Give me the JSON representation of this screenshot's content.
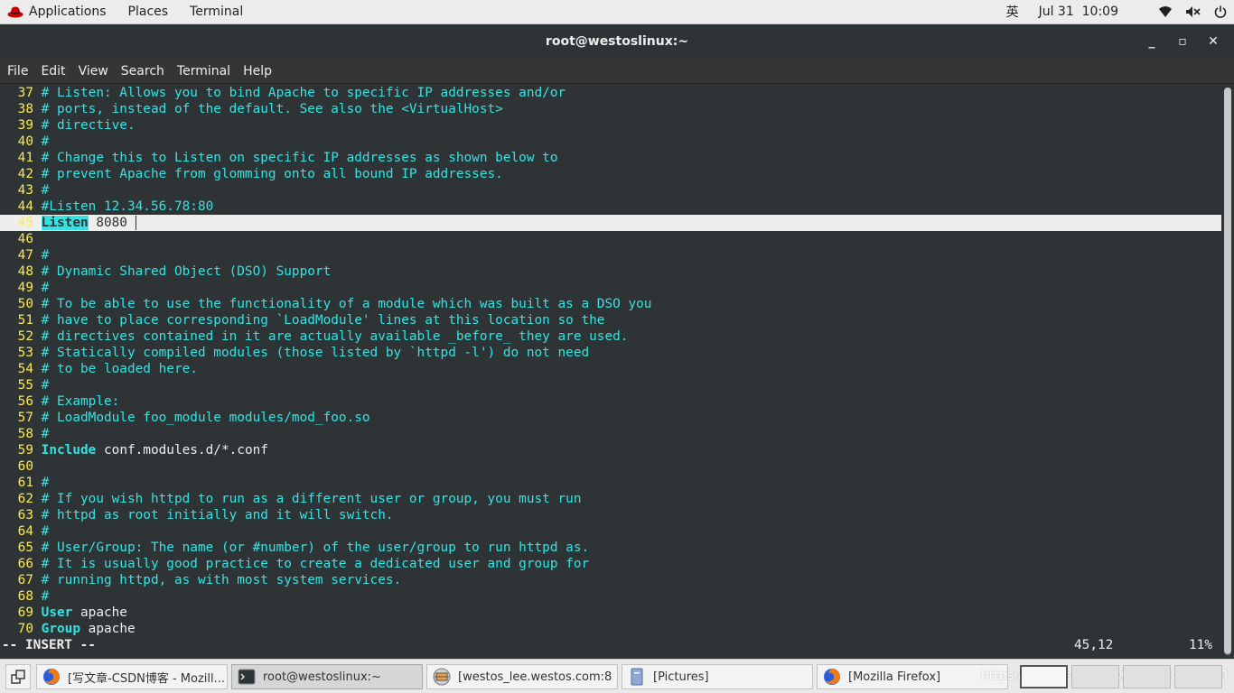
{
  "topbar": {
    "applications": "Applications",
    "places": "Places",
    "terminal": "Terminal",
    "input_method": "英",
    "clock": "Jul 31  10:09"
  },
  "window": {
    "title": "root@westoslinux:~",
    "minimize": "_",
    "maximize": "▫",
    "close": "✕"
  },
  "menubar": [
    "File",
    "Edit",
    "View",
    "Search",
    "Terminal",
    "Help"
  ],
  "editor": {
    "lines": [
      {
        "n": "37",
        "t": "# Listen: Allows you to bind Apache to specific IP addresses and/or"
      },
      {
        "n": "38",
        "t": "# ports, instead of the default. See also the <VirtualHost>"
      },
      {
        "n": "39",
        "t": "# directive."
      },
      {
        "n": "40",
        "t": "#"
      },
      {
        "n": "41",
        "t": "# Change this to Listen on specific IP addresses as shown below to"
      },
      {
        "n": "42",
        "t": "# prevent Apache from glomming onto all bound IP addresses."
      },
      {
        "n": "43",
        "t": "#"
      },
      {
        "n": "44",
        "t": "#Listen 12.34.56.78:80"
      },
      {
        "n": "45",
        "kw": "Listen",
        "rest": " 8080",
        "current": true
      },
      {
        "n": "46",
        "t": ""
      },
      {
        "n": "47",
        "t": "#"
      },
      {
        "n": "48",
        "t": "# Dynamic Shared Object (DSO) Support"
      },
      {
        "n": "49",
        "t": "#"
      },
      {
        "n": "50",
        "t": "# To be able to use the functionality of a module which was built as a DSO you"
      },
      {
        "n": "51",
        "t": "# have to place corresponding `LoadModule' lines at this location so the"
      },
      {
        "n": "52",
        "t": "# directives contained in it are actually available _before_ they are used."
      },
      {
        "n": "53",
        "t": "# Statically compiled modules (those listed by `httpd -l') do not need"
      },
      {
        "n": "54",
        "t": "# to be loaded here."
      },
      {
        "n": "55",
        "t": "#"
      },
      {
        "n": "56",
        "t": "# Example:"
      },
      {
        "n": "57",
        "t": "# LoadModule foo_module modules/mod_foo.so"
      },
      {
        "n": "58",
        "t": "#"
      },
      {
        "n": "59",
        "kw": "Include",
        "rest": " conf.modules.d/*.conf"
      },
      {
        "n": "60",
        "t": ""
      },
      {
        "n": "61",
        "t": "#"
      },
      {
        "n": "62",
        "t": "# If you wish httpd to run as a different user or group, you must run"
      },
      {
        "n": "63",
        "t": "# httpd as root initially and it will switch."
      },
      {
        "n": "64",
        "t": "#"
      },
      {
        "n": "65",
        "t": "# User/Group: The name (or #number) of the user/group to run httpd as."
      },
      {
        "n": "66",
        "t": "# It is usually good practice to create a dedicated user and group for"
      },
      {
        "n": "67",
        "t": "# running httpd, as with most system services."
      },
      {
        "n": "68",
        "t": "#"
      },
      {
        "n": "69",
        "kw": "User",
        "rest": " apache"
      },
      {
        "n": "70",
        "kw": "Group",
        "rest": " apache"
      }
    ],
    "mode": "-- INSERT --",
    "position": "45,12",
    "percent": "11%"
  },
  "taskbar": {
    "tasks": [
      {
        "label": "[写文章-CSDN博客 - Mozill...",
        "icon": "firefox-icon"
      },
      {
        "label": "root@westoslinux:~",
        "icon": "terminal-icon",
        "active": true
      },
      {
        "label": "[westos_lee.westos.com:8 ...",
        "icon": "remote-viewer-icon"
      },
      {
        "label": "[Pictures]",
        "icon": "file-manager-icon"
      },
      {
        "label": "[Mozilla Firefox]",
        "icon": "firefox-icon"
      }
    ],
    "watermark": "https://blog.csdn.net/weixin_40803940"
  },
  "colors": {
    "terminal_bg": "#2e3436",
    "comment": "#34e2e2",
    "line_number": "#fce94f",
    "fg": "#eeeeec"
  }
}
